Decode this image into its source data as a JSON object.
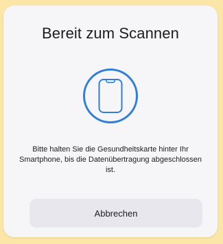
{
  "dialog": {
    "title": "Bereit zum Scannen",
    "icon": "smartphone-icon",
    "message": "Bitte halten Sie die Gesundheitskarte hinter Ihr Smartphone, bis die Datenübertragung abgeschlossen ist.",
    "cancel_label": "Abbrechen"
  },
  "colors": {
    "background": "#fbe6a7",
    "sheet": "#f6f5f8",
    "accent": "#2d7fd8",
    "button": "#e8e7ed",
    "text": "#1c1c1e"
  }
}
